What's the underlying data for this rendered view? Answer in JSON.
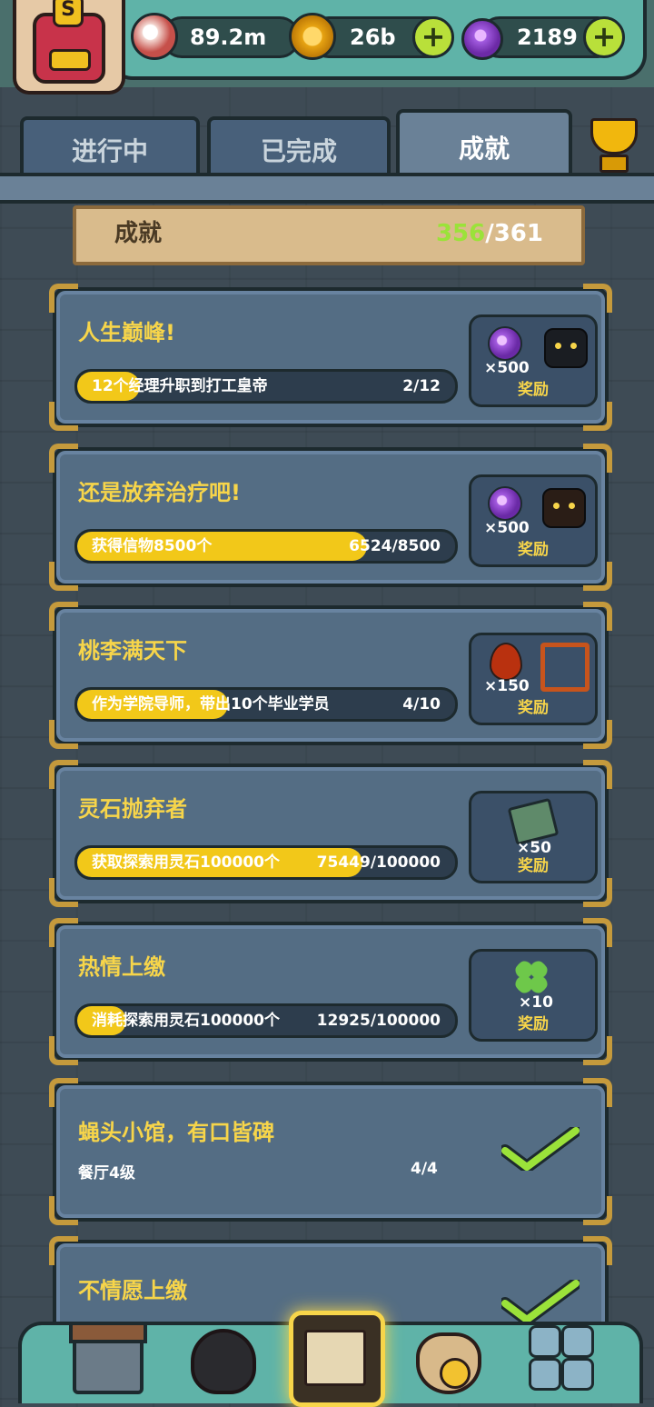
{
  "resources": {
    "eyes": "89.2m",
    "coins": "26b",
    "potions": "2189",
    "plus": "+"
  },
  "badge": {
    "letter": "S"
  },
  "tabs": [
    {
      "label": "进行中",
      "active": false
    },
    {
      "label": "已完成",
      "active": false
    },
    {
      "label": "成就",
      "active": true
    }
  ],
  "summary": {
    "label": "成就",
    "completed": "356",
    "total": "/361"
  },
  "reward_label": "奖励",
  "achievements": [
    {
      "title": "人生巅峰!",
      "desc": "12个经理升职到打工皇帝",
      "progress": "2/12",
      "fraction": 0.1667,
      "rewards": [
        "×500"
      ]
    },
    {
      "title": "还是放弃治疗吧!",
      "desc": "获得信物8500个",
      "progress": "6524/8500",
      "fraction": 0.7675,
      "rewards": [
        "×500"
      ]
    },
    {
      "title": "桃李满天下",
      "desc": "作为学院导师，带出10个毕业学员",
      "progress": "4/10",
      "fraction": 0.4,
      "rewards": [
        "×150"
      ]
    },
    {
      "title": "灵石抛弃者",
      "desc": "获取探索用灵石100000个",
      "progress": "75449/100000",
      "fraction": 0.7545,
      "rewards": [
        "×50"
      ]
    },
    {
      "title": "热情上缴",
      "desc": "消耗探索用灵石100000个",
      "progress": "12925/100000",
      "fraction": 0.1293,
      "rewards": [
        "×10"
      ]
    },
    {
      "title": "蝇头小馆，有口皆碑",
      "desc": "餐厅4级",
      "progress": "4/4",
      "fraction": 1,
      "completed": true
    },
    {
      "title": "不情愿上缴",
      "completed": true
    }
  ],
  "colors": {
    "accent_yellow": "#f7d54a",
    "progress_fill": "#f2c819",
    "completed_green": "#9be23a",
    "card_bg": "#546d84"
  }
}
